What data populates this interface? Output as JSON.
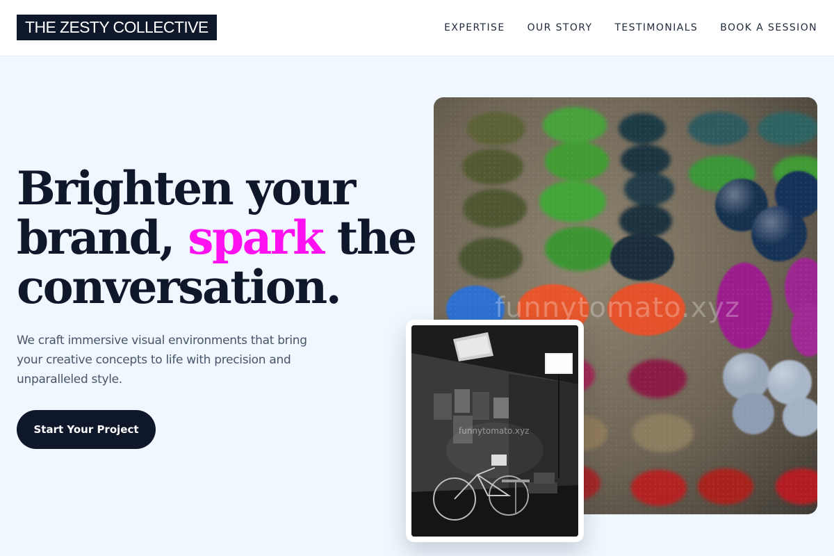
{
  "header": {
    "logo": "THE ZESTY COLLECTIVE",
    "nav": [
      {
        "label": "EXPERTISE"
      },
      {
        "label": "OUR STORY"
      },
      {
        "label": "TESTIMONIALS"
      },
      {
        "label": "BOOK A SESSION"
      }
    ]
  },
  "hero": {
    "headline_line1": "Brighten your",
    "headline_line2_pre": "brand, ",
    "headline_accent": "spark",
    "headline_line2_post": " the",
    "headline_line3": "conversation.",
    "subtext": "We craft immersive visual environments that bring your creative concepts to life with precision and unparalleled style.",
    "cta_label": "Start Your Project"
  },
  "images": {
    "main_watermark": "funnytomato.xyz",
    "inset_watermark": "funnytomato.xyz"
  },
  "colors": {
    "primary": "#0f172a",
    "accent": "#ff10f0",
    "background": "#f0f7fe"
  }
}
